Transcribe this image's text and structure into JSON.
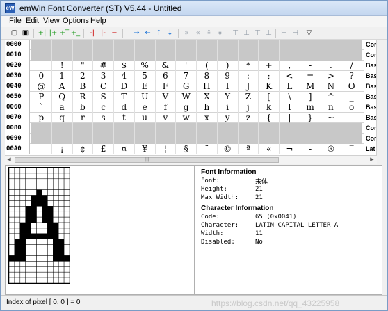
{
  "window": {
    "title": "emWin Font Converter (ST) V5.44 - Untitled",
    "app_icon": "emwin-app-icon",
    "app_icon_text": "eW"
  },
  "menu": [
    "File",
    "Edit",
    "View",
    "Options",
    "Help"
  ],
  "toolbar": {
    "icons": [
      "new-file-icon",
      "save-icon",
      "insert-column-left-icon",
      "insert-column-right-icon",
      "insert-row-top-icon",
      "insert-row-bottom-icon",
      "delete-column-left-icon",
      "delete-column-right-icon",
      "delete-row-icon",
      "shift-right-icon",
      "shift-left-icon",
      "shift-up-icon",
      "shift-down-icon",
      "move-right-disabled-icon",
      "move-left-disabled-icon",
      "move-up-disabled-icon",
      "move-down-disabled-icon",
      "align-top-disabled-icon",
      "align-bottom-disabled-icon",
      "align-middle-disabled-icon",
      "align-baseline-disabled-icon",
      "align-left-disabled-icon",
      "align-right-disabled-icon",
      "filter-icon"
    ],
    "glyphs": [
      "▢",
      "▣",
      "+|",
      "|+",
      "+‾",
      "+_",
      "-|",
      "|-",
      "−",
      "→",
      "←",
      "↑",
      "↓",
      "»",
      "«",
      "⇞",
      "⇟",
      "⊤",
      "⊥",
      "⊤",
      "⊥",
      "⊢",
      "⊣",
      "▽"
    ]
  },
  "grid": {
    "rows": [
      {
        "code": "0000",
        "shaded": true,
        "chars": [
          "",
          "",
          "",
          "",
          "",
          "",
          "",
          "",
          "",
          "",
          "",
          "",
          "",
          "",
          "",
          ""
        ],
        "name": "Cor"
      },
      {
        "code": "0010",
        "shaded": true,
        "chars": [
          "",
          "",
          "",
          "",
          "",
          "",
          "",
          "",
          "",
          "",
          "",
          "",
          "",
          "",
          "",
          ""
        ],
        "name": "Cor"
      },
      {
        "code": "0020",
        "shaded": false,
        "chars": [
          "",
          "!",
          "\"",
          "#",
          "$",
          "%",
          "&",
          "'",
          "(",
          ")",
          "*",
          "+",
          ",",
          "-",
          ".",
          "/"
        ],
        "name": "Bas"
      },
      {
        "code": "0030",
        "shaded": false,
        "chars": [
          "0",
          "1",
          "2",
          "3",
          "4",
          "5",
          "6",
          "7",
          "8",
          "9",
          ":",
          ";",
          "<",
          "=",
          ">",
          "?"
        ],
        "name": "Bas"
      },
      {
        "code": "0040",
        "shaded": false,
        "chars": [
          "@",
          "A",
          "B",
          "C",
          "D",
          "E",
          "F",
          "G",
          "H",
          "I",
          "J",
          "K",
          "L",
          "M",
          "N",
          "O"
        ],
        "name": "Bas"
      },
      {
        "code": "0050",
        "shaded": false,
        "chars": [
          "P",
          "Q",
          "R",
          "S",
          "T",
          "U",
          "V",
          "W",
          "X",
          "Y",
          "Z",
          "[",
          "\\",
          "]",
          "^",
          "_"
        ],
        "name": "Bas"
      },
      {
        "code": "0060",
        "shaded": false,
        "chars": [
          "`",
          "a",
          "b",
          "c",
          "d",
          "e",
          "f",
          "g",
          "h",
          "i",
          "j",
          "k",
          "l",
          "m",
          "n",
          "o"
        ],
        "name": "Bas"
      },
      {
        "code": "0070",
        "shaded": false,
        "chars": [
          "p",
          "q",
          "r",
          "s",
          "t",
          "u",
          "v",
          "w",
          "x",
          "y",
          "z",
          "{",
          "|",
          "}",
          "~",
          ""
        ],
        "name": "Bas"
      },
      {
        "code": "0080",
        "shaded": true,
        "chars": [
          "",
          "",
          "",
          "",
          "",
          "",
          "",
          "",
          "",
          "",
          "",
          "",
          "",
          "",
          "",
          ""
        ],
        "name": "Cor"
      },
      {
        "code": "0090",
        "shaded": true,
        "chars": [
          "",
          "",
          "",
          "",
          "",
          "",
          "",
          "",
          "",
          "",
          "",
          "",
          "",
          "",
          "",
          ""
        ],
        "name": "Cor"
      },
      {
        "code": "00A0",
        "shaded": false,
        "chars": [
          "",
          "¡",
          "¢",
          "£",
          "¤",
          "¥",
          "¦",
          "§",
          "¨",
          "©",
          "ª",
          "«",
          "¬",
          "-",
          "®",
          "‾"
        ],
        "name": "Lat"
      }
    ]
  },
  "hscroll_label": "|||",
  "glyph": {
    "selected_cell_marker": true,
    "cols": 11,
    "rows": 21,
    "pixels": [
      "00000000000",
      "00000000000",
      "00000000000",
      "00000000000",
      "00000100000",
      "00001110000",
      "00001110000",
      "00011011000",
      "00011011000",
      "00011011000",
      "00110001100",
      "00110001100",
      "00111111100",
      "01100000110",
      "01100000110",
      "01100000110",
      "11100000111",
      "00000000000",
      "00000000000",
      "00000000000",
      "00000000000"
    ]
  },
  "font_info": {
    "title": "Font Information",
    "rows": [
      {
        "label": "Font:",
        "value": "宋体"
      },
      {
        "label": "Height:",
        "value": "21"
      },
      {
        "label": "Max Width:",
        "value": "21"
      }
    ]
  },
  "char_info": {
    "title": "Character Information",
    "rows": [
      {
        "label": "Code:",
        "value": "65 (0x0041)"
      },
      {
        "label": "Character:",
        "value": "LATIN CAPITAL LETTER A"
      },
      {
        "label": "Width:",
        "value": "11"
      },
      {
        "label": "Disabled:",
        "value": "No"
      }
    ]
  },
  "status": {
    "text": "Index of pixel [ 0, 0 ] = 0",
    "watermark": "https://blog.csdn.net/qq_43225958"
  }
}
